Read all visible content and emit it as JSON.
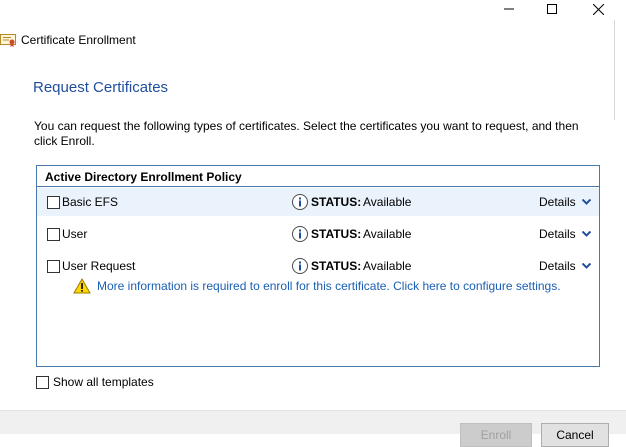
{
  "window": {
    "title": "Certificate Enrollment",
    "controls": {
      "minimize": "minimize-icon",
      "maximize": "maximize-icon",
      "close": "close-icon"
    }
  },
  "page": {
    "title": "Request Certificates",
    "description": "You can request the following types of certificates. Select the certificates you want to request, and then click Enroll."
  },
  "policy": {
    "header": "Active Directory Enrollment Policy",
    "items": [
      {
        "label": "Basic EFS",
        "status_key": "STATUS:",
        "status_value": "Available",
        "details": "Details",
        "checked": false,
        "selected": true
      },
      {
        "label": "User",
        "status_key": "STATUS:",
        "status_value": "Available",
        "details": "Details",
        "checked": false,
        "selected": false
      },
      {
        "label": "User Request",
        "status_key": "STATUS:",
        "status_value": "Available",
        "details": "Details",
        "checked": false,
        "selected": false
      }
    ],
    "warning": "More information is required to enroll for this certificate. Click here to configure settings."
  },
  "options": {
    "show_all_templates": "Show all templates"
  },
  "footer": {
    "enroll": "Enroll",
    "cancel": "Cancel"
  },
  "colors": {
    "title_blue": "#1f4e9c",
    "link_blue": "#1a5fb4",
    "panel_border": "#4a78a8",
    "row_highlight": "#eaf2fb"
  }
}
